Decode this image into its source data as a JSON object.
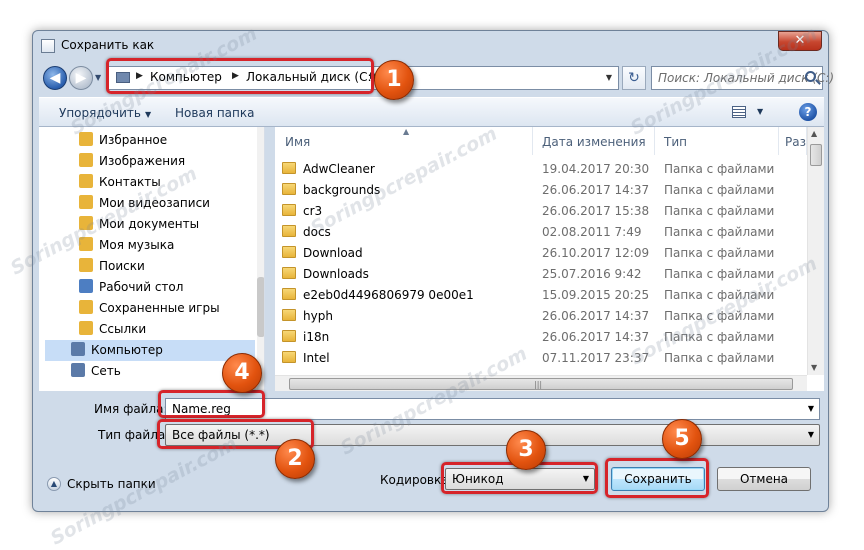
{
  "window": {
    "title": "Сохранить как",
    "close_label": "✕"
  },
  "nav": {
    "back_label": "◀",
    "forward_label": "▶",
    "breadcrumb": [
      "Компьютер",
      "Локальный диск (C:)"
    ],
    "refresh_label": "↻",
    "search_placeholder": "Поиск: Локальный диск (C:)"
  },
  "toolbar": {
    "organize_label": "Упорядочить",
    "new_folder_label": "Новая папка",
    "help_label": "?"
  },
  "sidebar": {
    "items": [
      {
        "label": "Избранное",
        "icon": "star-folder-icon",
        "color": "#e8b43a"
      },
      {
        "label": "Изображения",
        "icon": "pictures-folder-icon",
        "color": "#e8b43a"
      },
      {
        "label": "Контакты",
        "icon": "contacts-folder-icon",
        "color": "#e8b43a"
      },
      {
        "label": "Мои видеозаписи",
        "icon": "videos-folder-icon",
        "color": "#e8b43a"
      },
      {
        "label": "Мои документы",
        "icon": "documents-folder-icon",
        "color": "#e8b43a"
      },
      {
        "label": "Моя музыка",
        "icon": "music-folder-icon",
        "color": "#e8b43a"
      },
      {
        "label": "Поиски",
        "icon": "searches-folder-icon",
        "color": "#e8b43a"
      },
      {
        "label": "Рабочий стол",
        "icon": "desktop-folder-icon",
        "color": "#4d7ec2"
      },
      {
        "label": "Сохраненные игры",
        "icon": "games-folder-icon",
        "color": "#e8b43a"
      },
      {
        "label": "Ссылки",
        "icon": "links-folder-icon",
        "color": "#e8b43a"
      },
      {
        "label": "Компьютер",
        "icon": "computer-icon",
        "color": "#5b7aa8"
      },
      {
        "label": "Сеть",
        "icon": "network-icon",
        "color": "#5b7aa8"
      }
    ]
  },
  "files": {
    "columns": {
      "name": "Имя",
      "date": "Дата изменения",
      "type": "Тип",
      "size": "Разм"
    },
    "rows": [
      {
        "name": "AdwCleaner",
        "date": "19.04.2017 20:30",
        "type": "Папка с файлами"
      },
      {
        "name": "backgrounds",
        "date": "26.06.2017 14:37",
        "type": "Папка с файлами"
      },
      {
        "name": "cr3",
        "date": "26.06.2017 15:38",
        "type": "Папка с файлами"
      },
      {
        "name": "docs",
        "date": "02.08.2011 7:49",
        "type": "Папка с файлами"
      },
      {
        "name": "Download",
        "date": "26.10.2017 12:09",
        "type": "Папка с файлами"
      },
      {
        "name": "Downloads",
        "date": "25.07.2016 9:42",
        "type": "Папка с файлами"
      },
      {
        "name": "e2eb0d4496806979 0e00e1",
        "date": "15.09.2015 20:25",
        "type": "Папка с файлами"
      },
      {
        "name": "hyph",
        "date": "26.06.2017 14:37",
        "type": "Папка с файлами"
      },
      {
        "name": "i18n",
        "date": "26.06.2017 14:37",
        "type": "Папка с файлами"
      },
      {
        "name": "Intel",
        "date": "07.11.2017 23:37",
        "type": "Папка с файлами"
      }
    ]
  },
  "form": {
    "filename_label": "Имя файла:",
    "filename_value": "Name.reg",
    "filetype_label": "Тип файла:",
    "filetype_value": "Все файлы  (*.*)",
    "encoding_label": "Кодировка:",
    "encoding_value": "Юникод"
  },
  "footer": {
    "hide_folders_label": "Скрыть папки",
    "save_label": "Сохранить",
    "cancel_label": "Отмена"
  },
  "annotations": {
    "badge1": "1",
    "badge2": "2",
    "badge3": "3",
    "badge4": "4",
    "badge5": "5"
  },
  "watermark_text": "Soringpcrepair.com",
  "colors": {
    "highlight_red": "#d6242a",
    "badge_orange": "#e2530f",
    "window_frame": "#cfdbe9",
    "selected_nav": "#c7ddf7"
  }
}
